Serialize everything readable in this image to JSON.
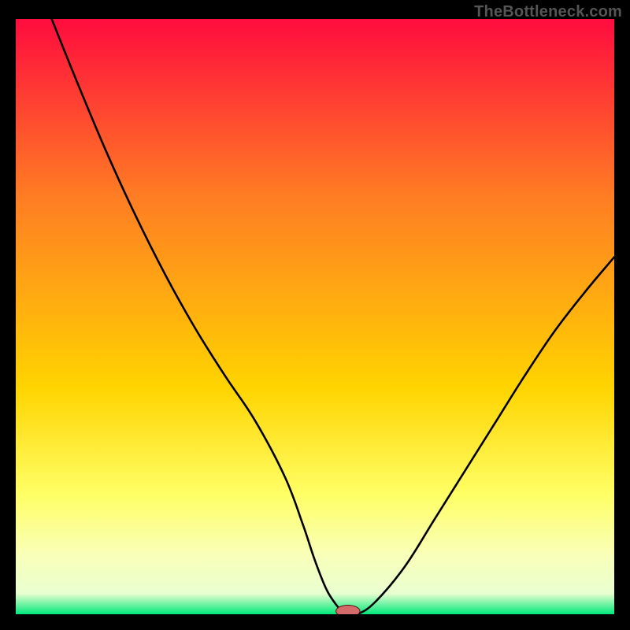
{
  "watermark": "TheBottleneck.com",
  "colors": {
    "background": "#000000",
    "gradient_top": "#ff0c3e",
    "gradient_mid1": "#ff7d23",
    "gradient_mid2": "#ffd400",
    "gradient_mid3": "#ffff66",
    "gradient_mid4": "#f9ffb8",
    "gradient_bottom": "#00e87a",
    "curve": "#000000",
    "marker_fill": "#d46a6a",
    "marker_stroke": "#5b0f0f"
  },
  "chart_data": {
    "type": "line",
    "title": "",
    "xlabel": "",
    "ylabel": "",
    "xlim": [
      0,
      100
    ],
    "ylim": [
      0,
      100
    ],
    "x": [
      6,
      10,
      15,
      20,
      25,
      30,
      35,
      40,
      45,
      48,
      50,
      52,
      54,
      55,
      57,
      60,
      65,
      70,
      75,
      80,
      85,
      90,
      95,
      100
    ],
    "values": [
      100,
      90,
      78,
      67,
      57,
      48,
      40,
      32.5,
      23,
      15,
      9,
      4,
      1,
      0,
      0,
      2,
      8,
      16,
      24,
      32,
      40,
      47.5,
      54,
      60
    ],
    "marker": {
      "x": 55.5,
      "y": 0,
      "rx": 2.0,
      "ry": 1.0
    },
    "gradient_stops": [
      {
        "offset": 0.0,
        "color": "#ff0c3e"
      },
      {
        "offset": 0.3,
        "color": "#ff7d23"
      },
      {
        "offset": 0.62,
        "color": "#ffd400"
      },
      {
        "offset": 0.8,
        "color": "#ffff66"
      },
      {
        "offset": 0.9,
        "color": "#f9ffb8"
      },
      {
        "offset": 0.965,
        "color": "#e9ffd0"
      },
      {
        "offset": 1.0,
        "color": "#00e87a"
      }
    ]
  }
}
